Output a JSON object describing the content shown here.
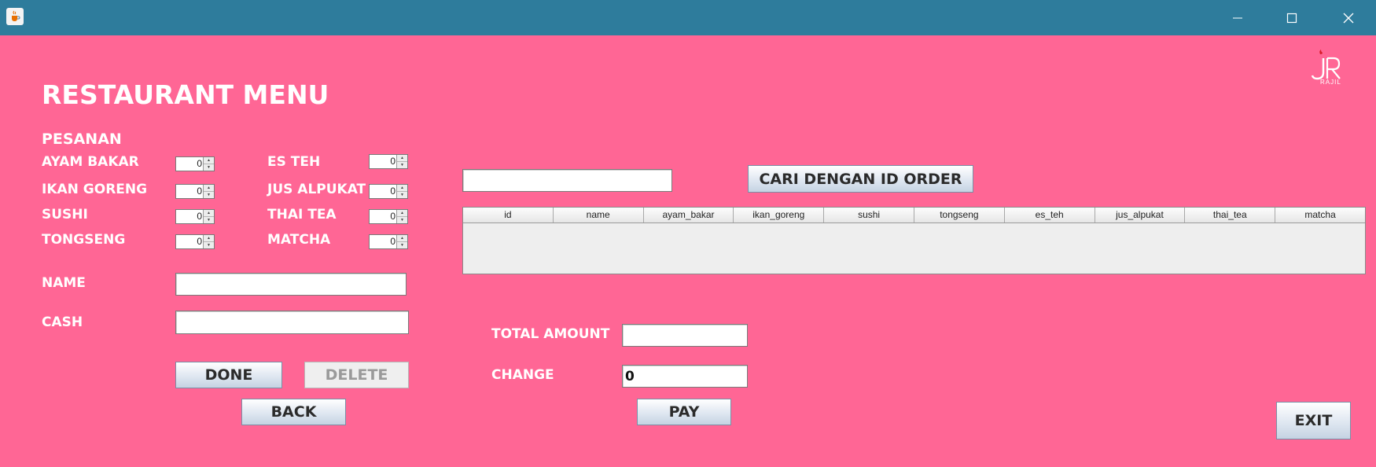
{
  "window": {
    "app_icon": "java-cup-icon",
    "controls": [
      "minimize-icon",
      "maximize-icon",
      "close-icon"
    ]
  },
  "header": {
    "title": "RESTAURANT MENU",
    "logo_text": "RAJIL"
  },
  "order": {
    "section_label": "PESANAN",
    "items": [
      {
        "label": "AYAM BAKAR",
        "value": "0"
      },
      {
        "label": "IKAN GORENG",
        "value": "0"
      },
      {
        "label": "SUSHI",
        "value": "0"
      },
      {
        "label": "TONGSENG",
        "value": "0"
      },
      {
        "label": "ES TEH",
        "value": "0"
      },
      {
        "label": "JUS ALPUKAT",
        "value": "0"
      },
      {
        "label": "THAI TEA",
        "value": "0"
      },
      {
        "label": "MATCHA",
        "value": "0"
      }
    ]
  },
  "form": {
    "name_label": "NAME",
    "name_value": "",
    "cash_label": "CASH",
    "cash_value": ""
  },
  "buttons": {
    "done": "DONE",
    "delete": "DELETE",
    "back": "BACK",
    "pay": "PAY",
    "exit": "EXIT",
    "search": "CARI DENGAN ID ORDER"
  },
  "search": {
    "value": ""
  },
  "table": {
    "columns": [
      "id",
      "name",
      "ayam_bakar",
      "ikan_goreng",
      "sushi",
      "tongseng",
      "es_teh",
      "jus_alpukat",
      "thai_tea",
      "matcha"
    ],
    "rows": []
  },
  "payment": {
    "total_label": "TOTAL AMOUNT",
    "total_value": "",
    "change_label": "CHANGE",
    "change_value": "0"
  },
  "colors": {
    "background": "#ff6695",
    "titlebar": "#2e7c9c"
  }
}
